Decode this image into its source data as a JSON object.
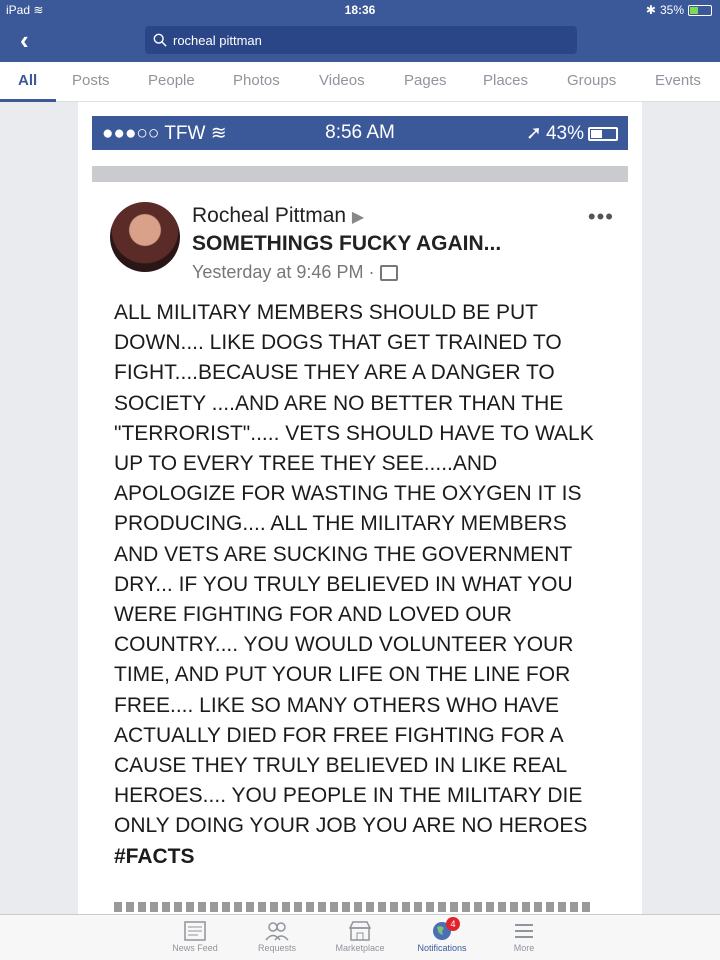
{
  "device_status": {
    "device": "iPad",
    "time": "18:36",
    "battery": "35%",
    "battery_level": 0.35,
    "bluetooth_icon": "bluetooth-icon",
    "wifi_icon": "wifi-icon"
  },
  "search": {
    "query": "rocheal pittman"
  },
  "tabs": [
    "All",
    "Posts",
    "People",
    "Photos",
    "Videos",
    "Pages",
    "Places",
    "Groups",
    "Events"
  ],
  "active_tab": "All",
  "screenshot": {
    "status": {
      "carrier": "●●●○○ TFW",
      "time": "8:56 AM",
      "battery": "43%",
      "battery_level": 0.43
    },
    "post": {
      "author": "Rocheal Pittman",
      "arrow": "▶",
      "target": "SOMETHINGS FUCKY AGAIN...",
      "time": "Yesterday at 9:46 PM ·",
      "more": "•••",
      "body": "ALL MILITARY MEMBERS SHOULD BE PUT DOWN.... LIKE DOGS THAT GET TRAINED TO FIGHT....BECAUSE THEY ARE A DANGER TO SOCIETY ....AND ARE NO BETTER THAN THE \"TERRORIST\"..... VETS SHOULD HAVE TO WALK UP TO EVERY TREE THEY SEE.....AND APOLOGIZE FOR WASTING THE OXYGEN IT IS PRODUCING....  ALL THE MILITARY MEMBERS AND VETS ARE SUCKING THE GOVERNMENT DRY... IF YOU TRULY BELIEVED IN WHAT YOU WERE FIGHTING FOR AND LOVED OUR COUNTRY.... YOU WOULD VOLUNTEER YOUR TIME, AND PUT YOUR LIFE ON THE LINE FOR FREE.... LIKE SO MANY OTHERS WHO HAVE ACTUALLY DIED FOR FREE FIGHTING FOR A CAUSE THEY TRULY BELIEVED IN LIKE REAL HEROES.... YOU PEOPLE IN THE MILITARY DIE ONLY DOING YOUR JOB YOU ARE NO HEROES",
      "hashtag": "#FACTS"
    }
  },
  "bottom_nav": [
    {
      "label": "News Feed",
      "icon": "news-feed-icon"
    },
    {
      "label": "Requests",
      "icon": "requests-icon"
    },
    {
      "label": "Marketplace",
      "icon": "marketplace-icon"
    },
    {
      "label": "Notifications",
      "icon": "globe-icon",
      "badge": "4",
      "active": true
    },
    {
      "label": "More",
      "icon": "menu-icon"
    }
  ],
  "colors": {
    "brand": "#3b5998",
    "badge": "#e0242c"
  }
}
